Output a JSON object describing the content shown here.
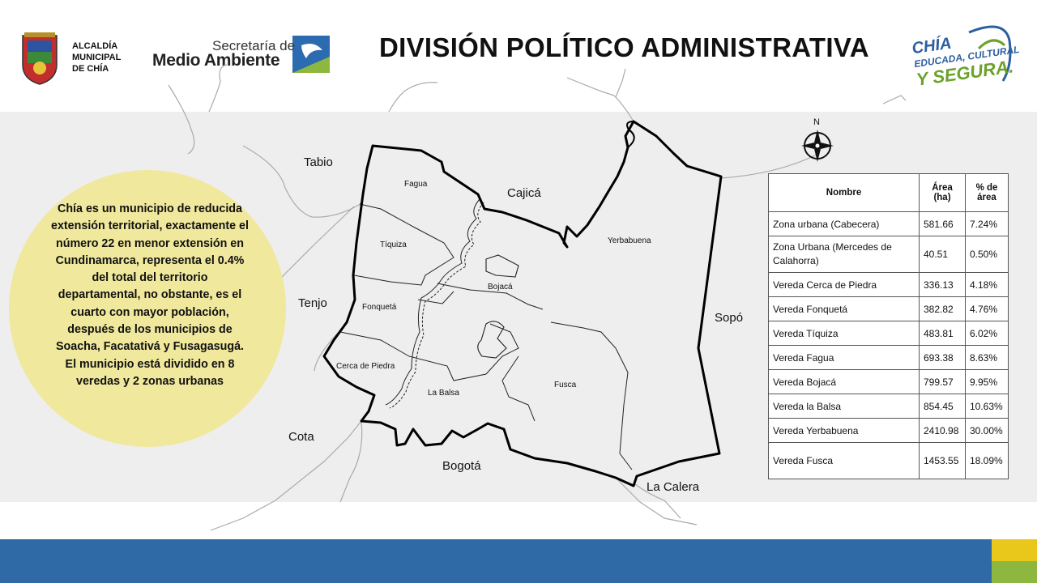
{
  "header": {
    "title": "DIVISIÓN POLÍTICO ADMINISTRATIVA",
    "alcaldia": "ALCALDÍA MUNICIPAL DE CHÍA",
    "secretaria_line1": "Secretaría de",
    "secretaria_line2": "Medio Ambiente",
    "brand_line1": "CHÍA",
    "brand_line2": "EDUCADA, CULTURAL",
    "brand_line3": "Y SEGURA."
  },
  "info": {
    "text": "Chía es un municipio de reducida extensión territorial, exactamente el número 22 en menor extensión en Cundinamarca, representa el 0.4% del total del territorio departamental, no obstante, es el cuarto con mayor población, después de los municipios de Soacha, Facatativá y Fusagasugá. El municipio está dividido en 8 veredas y 2 zonas urbanas"
  },
  "map": {
    "neighbors": [
      "Tabio",
      "Cajicá",
      "Tenjo",
      "Sopó",
      "Cota",
      "Bogotá",
      "La Calera"
    ],
    "veredas": [
      "Fagua",
      "Tíquiza",
      "Fonquetá",
      "Cerca de Piedra",
      "Bojacá",
      "La Balsa",
      "Fusca",
      "Yerbabuena"
    ],
    "north_label": "N"
  },
  "table": {
    "headers": [
      "Nombre",
      "Área (ha)",
      "% de área"
    ],
    "rows": [
      {
        "nombre": "Zona urbana (Cabecera)",
        "area": "581.66",
        "pct": "7.24%"
      },
      {
        "nombre": "Zona Urbana (Mercedes de Calahorra)",
        "area": "40.51",
        "pct": "0.50%"
      },
      {
        "nombre": "Vereda Cerca de Piedra",
        "area": "336.13",
        "pct": "4.18%"
      },
      {
        "nombre": "Vereda Fonquetá",
        "area": "382.82",
        "pct": "4.76%"
      },
      {
        "nombre": "Vereda Tíquiza",
        "area": "483.81",
        "pct": "6.02%"
      },
      {
        "nombre": "Vereda Fagua",
        "area": "693.38",
        "pct": "8.63%"
      },
      {
        "nombre": "Vereda Bojacá",
        "area": "799.57",
        "pct": "9.95%"
      },
      {
        "nombre": "Vereda la Balsa",
        "area": "854.45",
        "pct": "10.63%"
      },
      {
        "nombre": "Vereda Yerbabuena",
        "area": "2410.98",
        "pct": "30.00%"
      },
      {
        "nombre": "Vereda Fusca",
        "area": "1453.55",
        "pct": "18.09%"
      }
    ]
  },
  "colors": {
    "footer_blue": "#2f6aa6",
    "footer_yellow": "#e9c81b",
    "footer_green": "#8db73e",
    "info_circle": "#f0e89c",
    "map_background": "#eeeeee"
  }
}
